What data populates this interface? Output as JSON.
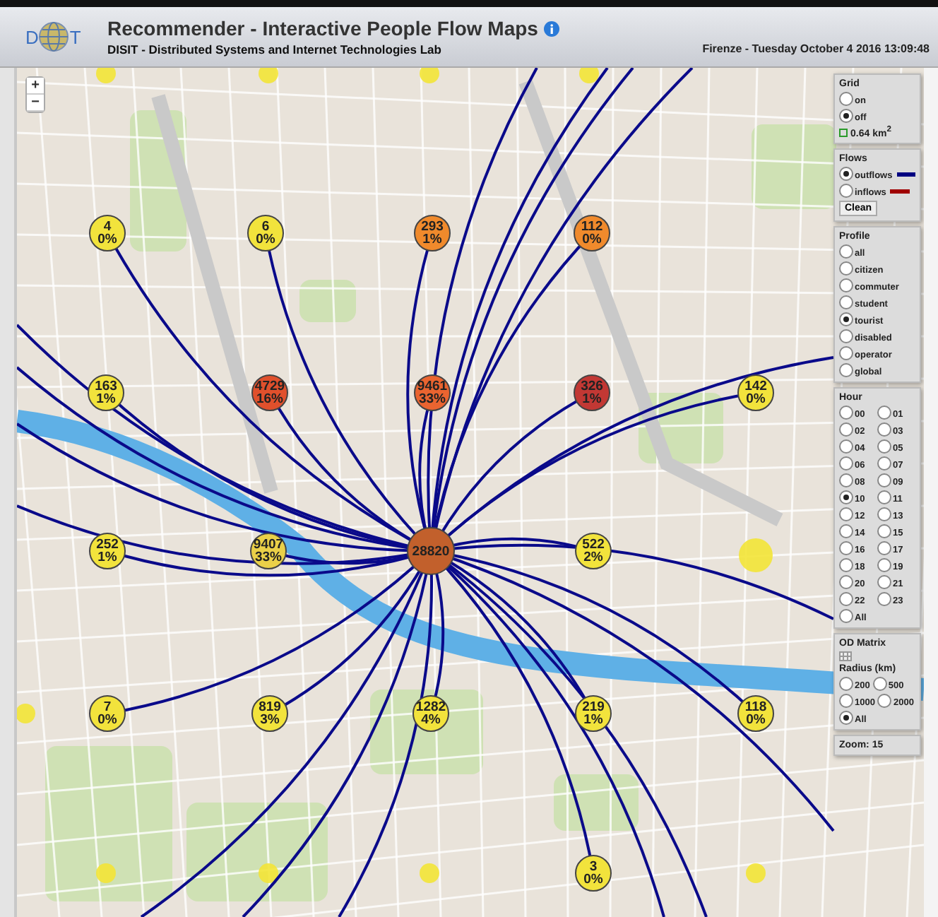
{
  "header": {
    "logo": [
      "D",
      "T"
    ],
    "title": "Recommender - Interactive People Flow Maps",
    "subtitle": "DISIT - Distributed Systems and Internet Technologies Lab",
    "datetime": "Firenze - Tuesday October 4 2016 13:09:48"
  },
  "map": {
    "zoom_buttons": [
      "+",
      "−"
    ],
    "markers": [
      {
        "count": "4",
        "percent": "0%",
        "color": "#f2e33c"
      },
      {
        "count": "6",
        "percent": "0%",
        "color": "#f2e33c"
      },
      {
        "count": "293",
        "percent": "1%",
        "color": "#f08a2c"
      },
      {
        "count": "112",
        "percent": "0%",
        "color": "#f08a2c"
      },
      {
        "count": "163",
        "percent": "1%",
        "color": "#f2e33c"
      },
      {
        "count": "4729",
        "percent": "16%",
        "color": "#e0502c"
      },
      {
        "count": "9461",
        "percent": "33%",
        "color": "#ea6430"
      },
      {
        "count": "326",
        "percent": "1%",
        "color": "#c23834"
      },
      {
        "count": "142",
        "percent": "0%",
        "color": "#f2e33c"
      },
      {
        "count": "252",
        "percent": "1%",
        "color": "#f2e33c"
      },
      {
        "count": "9407",
        "percent": "33%",
        "color": "#ead048"
      },
      {
        "count": "28820",
        "color": "#c2602c"
      },
      {
        "count": "522",
        "percent": "2%",
        "color": "#f2e33c"
      },
      {
        "count": "7",
        "percent": "0%",
        "color": "#f2e33c"
      },
      {
        "count": "819",
        "percent": "3%",
        "color": "#f2e33c"
      },
      {
        "count": "1282",
        "percent": "4%",
        "color": "#f2e33c"
      },
      {
        "count": "219",
        "percent": "1%",
        "color": "#f2e33c"
      },
      {
        "count": "118",
        "percent": "0%",
        "color": "#f2e33c"
      },
      {
        "count": "3",
        "percent": "0%",
        "color": "#f2e33c"
      }
    ]
  },
  "panel": {
    "grid": {
      "title": "Grid",
      "options": [
        {
          "label": "on",
          "selected": false
        },
        {
          "label": "off",
          "selected": true
        }
      ],
      "cell_size": "0.64 km$^{2}$"
    },
    "flows": {
      "title": "Flows",
      "options": [
        {
          "label": "outflows",
          "selected": true,
          "color": "#000080"
        },
        {
          "label": "inflows",
          "selected": false,
          "color": "#a00000"
        }
      ],
      "button": "Clean"
    },
    "profile": {
      "title": "Profile",
      "options": [
        {
          "label": "all",
          "selected": false
        },
        {
          "label": "citizen",
          "selected": false
        },
        {
          "label": "commuter",
          "selected": false
        },
        {
          "label": "student",
          "selected": false
        },
        {
          "label": "tourist",
          "selected": true
        },
        {
          "label": "disabled",
          "selected": false
        },
        {
          "label": "operator",
          "selected": false
        },
        {
          "label": "global",
          "selected": false
        }
      ]
    },
    "hour": {
      "title": "Hour",
      "options": [
        {
          "label": "00",
          "selected": false
        },
        {
          "label": "01",
          "selected": false
        },
        {
          "label": "02",
          "selected": false
        },
        {
          "label": "03",
          "selected": false
        },
        {
          "label": "04",
          "selected": false
        },
        {
          "label": "05",
          "selected": false
        },
        {
          "label": "06",
          "selected": false
        },
        {
          "label": "07",
          "selected": false
        },
        {
          "label": "08",
          "selected": false
        },
        {
          "label": "09",
          "selected": false
        },
        {
          "label": "10",
          "selected": true
        },
        {
          "label": "11",
          "selected": false
        },
        {
          "label": "12",
          "selected": false
        },
        {
          "label": "13",
          "selected": false
        },
        {
          "label": "14",
          "selected": false
        },
        {
          "label": "15",
          "selected": false
        },
        {
          "label": "16",
          "selected": false
        },
        {
          "label": "17",
          "selected": false
        },
        {
          "label": "18",
          "selected": false
        },
        {
          "label": "19",
          "selected": false
        },
        {
          "label": "20",
          "selected": false
        },
        {
          "label": "21",
          "selected": false
        },
        {
          "label": "22",
          "selected": false
        },
        {
          "label": "23",
          "selected": false
        },
        {
          "label": "All",
          "selected": false
        }
      ]
    },
    "od_matrix": {
      "title": "OD Matrix",
      "radius_title": "Radius (km)",
      "radius_options": [
        {
          "label": "200",
          "selected": false
        },
        {
          "label": "500",
          "selected": false
        },
        {
          "label": "1000",
          "selected": false
        },
        {
          "label": "2000",
          "selected": false
        },
        {
          "label": "All",
          "selected": true
        }
      ]
    },
    "zoom": "Zoom: 15"
  }
}
